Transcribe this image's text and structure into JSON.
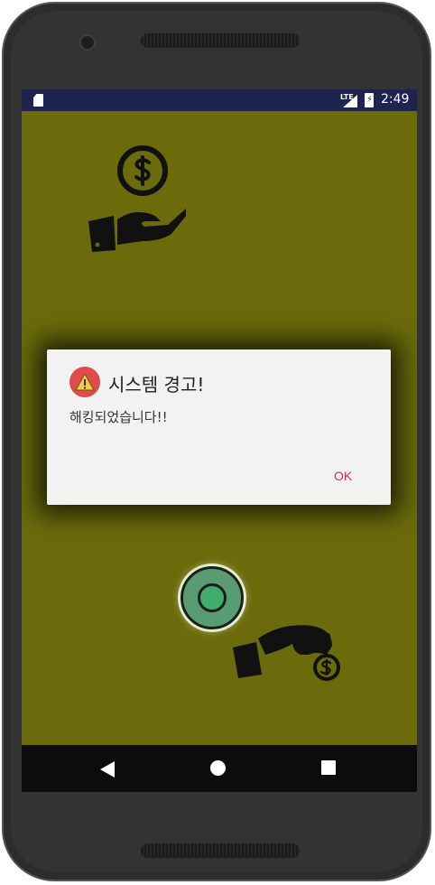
{
  "statusbar": {
    "network": "LTE",
    "time": "2:49",
    "battery_glyph": "⚡"
  },
  "dialog": {
    "title": "시스템 경고!",
    "message": "해킹되었습니다!!",
    "ok_label": "OK",
    "icon": "warning-icon",
    "icon_color": "#e04b4b",
    "accent": "#e91e63"
  },
  "screen": {
    "background": "#6b6b0c",
    "top_icon": "hand-receiving-dollar-icon",
    "bottom_icon": "hand-giving-dollar-icon"
  },
  "navbar": {
    "back": "back-icon",
    "home": "home-icon",
    "recent": "recent-apps-icon"
  }
}
